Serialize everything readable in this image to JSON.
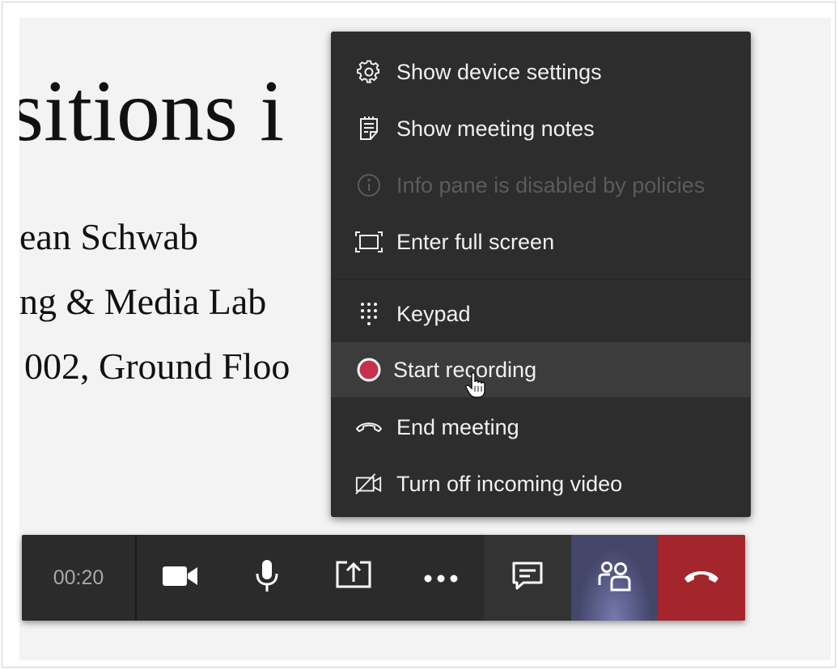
{
  "slide": {
    "title_fragment": "sitions i",
    "line1": "ean Schwab",
    "line2": "ng & Media Lab",
    "line3": "002, Ground Floo"
  },
  "menu": {
    "items": [
      {
        "label": "Show device settings",
        "icon": "gear-icon",
        "enabled": true
      },
      {
        "label": "Show meeting notes",
        "icon": "notes-icon",
        "enabled": true
      },
      {
        "label": "Info pane is disabled by policies",
        "icon": "info-icon",
        "enabled": false
      },
      {
        "label": "Enter full screen",
        "icon": "fullscreen-icon",
        "enabled": true
      },
      {
        "label": "Keypad",
        "icon": "keypad-icon",
        "enabled": true
      },
      {
        "label": "Start recording",
        "icon": "record-icon",
        "enabled": true,
        "hovered": true
      },
      {
        "label": "End meeting",
        "icon": "end-call-icon",
        "enabled": true
      },
      {
        "label": "Turn off incoming video",
        "icon": "video-off-icon",
        "enabled": true
      }
    ]
  },
  "toolbar": {
    "timer": "00:20",
    "buttons": [
      "camera-icon",
      "microphone-icon",
      "share-screen-icon",
      "more-options-icon",
      "chat-icon",
      "participants-icon",
      "hang-up-icon"
    ]
  },
  "colors": {
    "menu_bg": "#2d2d2d",
    "record_red": "#c4314b",
    "hangup_red": "#a4262c",
    "people_active": "#44466a"
  }
}
